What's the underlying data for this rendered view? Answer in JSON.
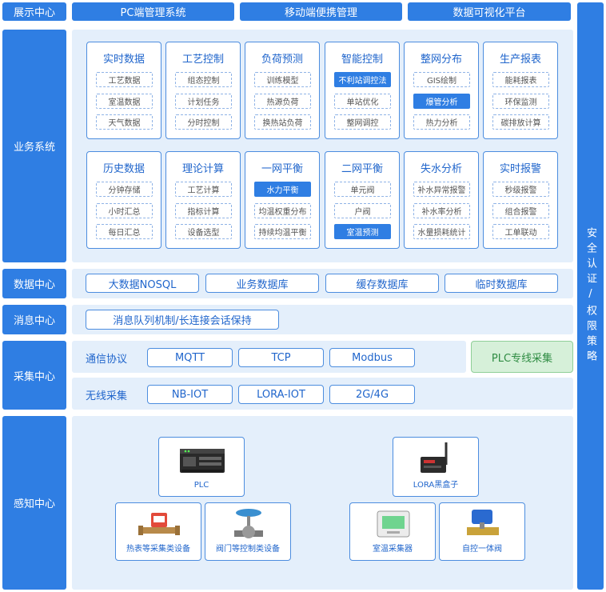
{
  "top": {
    "display_center": "展示中心",
    "pc": "PC端管理系统",
    "mobile": "移动端便携管理",
    "visual": "数据可视化平台"
  },
  "right_bar": "安全认证/权限策略",
  "business": {
    "label": "业务系统",
    "modules": [
      {
        "title": "实时数据",
        "items": [
          {
            "text": "工艺数据",
            "hl": false
          },
          {
            "text": "室温数据",
            "hl": false
          },
          {
            "text": "天气数据",
            "hl": false
          }
        ]
      },
      {
        "title": "工艺控制",
        "items": [
          {
            "text": "组态控制",
            "hl": false
          },
          {
            "text": "计划任务",
            "hl": false
          },
          {
            "text": "分时控制",
            "hl": false
          }
        ]
      },
      {
        "title": "负荷预测",
        "items": [
          {
            "text": "训练模型",
            "hl": false
          },
          {
            "text": "热源负荷",
            "hl": false
          },
          {
            "text": "换热站负荷",
            "hl": false
          }
        ]
      },
      {
        "title": "智能控制",
        "items": [
          {
            "text": "不利站调控法",
            "hl": true
          },
          {
            "text": "单站优化",
            "hl": false
          },
          {
            "text": "整网调控",
            "hl": false
          }
        ]
      },
      {
        "title": "整网分布",
        "items": [
          {
            "text": "GIS绘制",
            "hl": false
          },
          {
            "text": "爆管分析",
            "hl": true
          },
          {
            "text": "热力分析",
            "hl": false
          }
        ]
      },
      {
        "title": "生产报表",
        "items": [
          {
            "text": "能耗报表",
            "hl": false
          },
          {
            "text": "环保监测",
            "hl": false
          },
          {
            "text": "碳排放计算",
            "hl": false
          }
        ]
      },
      {
        "title": "历史数据",
        "items": [
          {
            "text": "分钟存储",
            "hl": false
          },
          {
            "text": "小时汇总",
            "hl": false
          },
          {
            "text": "每日汇总",
            "hl": false
          }
        ]
      },
      {
        "title": "理论计算",
        "items": [
          {
            "text": "工艺计算",
            "hl": false
          },
          {
            "text": "指标计算",
            "hl": false
          },
          {
            "text": "设备选型",
            "hl": false
          }
        ]
      },
      {
        "title": "一网平衡",
        "items": [
          {
            "text": "水力平衡",
            "hl": true
          },
          {
            "text": "均温权重分布",
            "hl": false
          },
          {
            "text": "持续均温平衡",
            "hl": false
          }
        ]
      },
      {
        "title": "二网平衡",
        "items": [
          {
            "text": "单元阀",
            "hl": false
          },
          {
            "text": "户阀",
            "hl": false
          },
          {
            "text": "室温预测",
            "hl": true
          }
        ]
      },
      {
        "title": "失水分析",
        "items": [
          {
            "text": "补水异常报警",
            "hl": false
          },
          {
            "text": "补水率分析",
            "hl": false
          },
          {
            "text": "水量损耗统计",
            "hl": false
          }
        ]
      },
      {
        "title": "实时报警",
        "items": [
          {
            "text": "秒级报警",
            "hl": false
          },
          {
            "text": "组合报警",
            "hl": false
          },
          {
            "text": "工单联动",
            "hl": false
          }
        ]
      }
    ]
  },
  "data_center": {
    "label": "数据中心",
    "items": [
      "大数据NOSQL",
      "业务数据库",
      "缓存数据库",
      "临时数据库"
    ]
  },
  "message_center": {
    "label": "消息中心",
    "item": "消息队列机制/长连接会话保持"
  },
  "collection_center": {
    "label": "采集中心",
    "protocol_label": "通信协议",
    "protocols": [
      "MQTT",
      "TCP",
      "Modbus"
    ],
    "plc_special": "PLC专线采集",
    "wireless_label": "无线采集",
    "wireless": [
      "NB-IOT",
      "LORA-IOT",
      "2G/4G"
    ]
  },
  "perception_center": {
    "label": "感知中心",
    "devices": {
      "plc": "PLC",
      "lora": "LORA黑盒子",
      "heat_meter": "热表等采集类设备",
      "valve": "阀门等控制类设备",
      "room_temp": "室温采集器",
      "auto_valve": "自控一体阀"
    }
  },
  "colors": {
    "primary": "#2f7ee3",
    "panel": "#e4effb",
    "text_blue": "#2166cc",
    "green_bg": "#d6f0d9"
  }
}
